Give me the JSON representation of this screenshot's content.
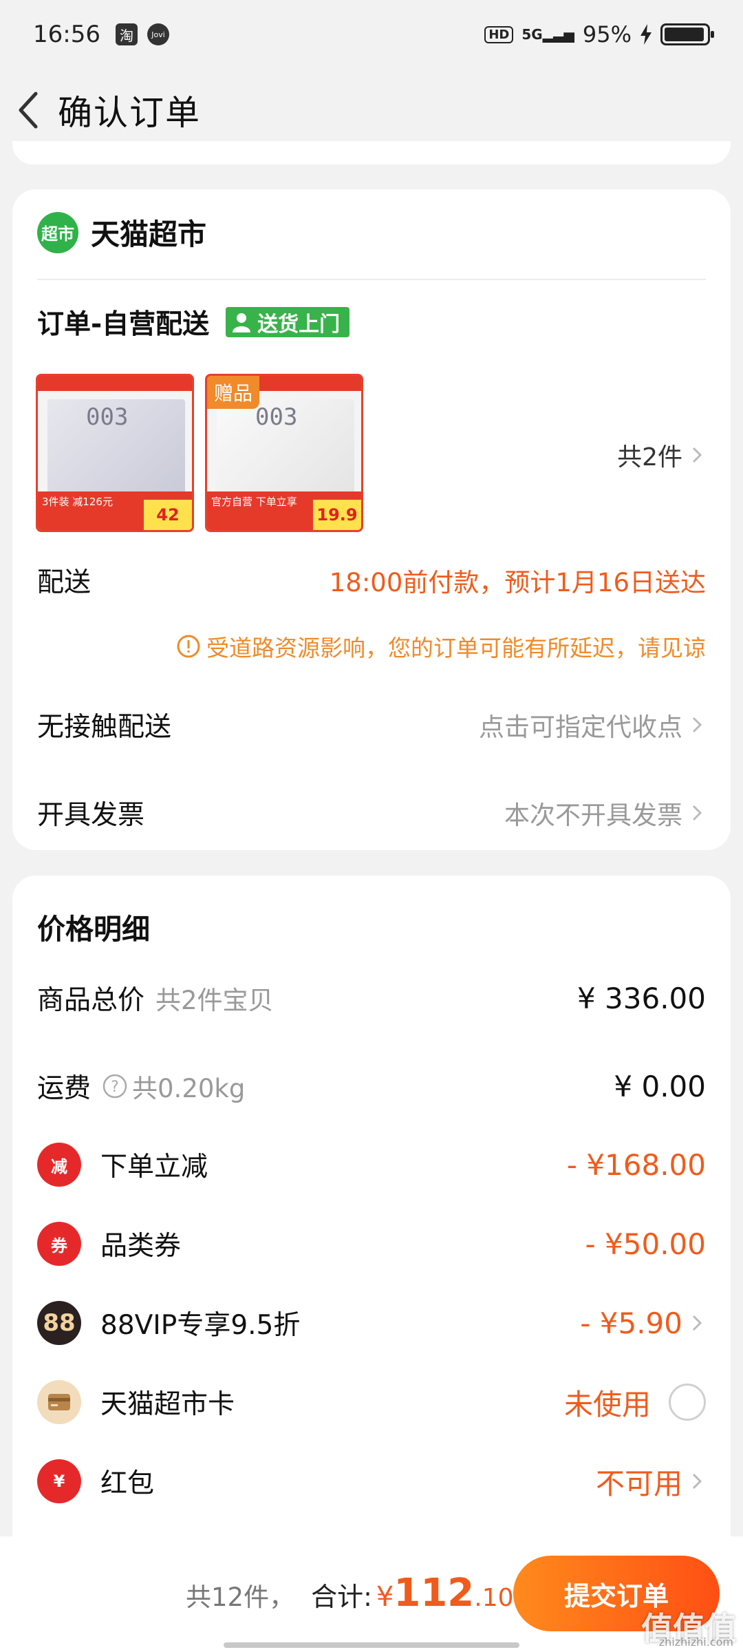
{
  "status_bar": {
    "time": "16:56",
    "app_icon_1": "淘",
    "app_icon_2": "Jovi",
    "hd": "HD",
    "network": "5G",
    "battery": "95%",
    "battery_level": 0.95
  },
  "nav": {
    "title": "确认订单"
  },
  "store": {
    "badge": "超市",
    "name": "天猫超市"
  },
  "order": {
    "title": "订单-自营配送",
    "delivery_tag": "送货上门",
    "items": [
      {
        "gift": "",
        "label": "003",
        "banner": "3件装 减126元",
        "price": "42"
      },
      {
        "gift": "赠品",
        "label": "003",
        "banner": "官方自营 下单立享",
        "price": "19.9"
      }
    ],
    "count": "共2件"
  },
  "delivery": {
    "label": "配送",
    "value": "18:00前付款，预计1月16日送达",
    "warning": "受道路资源影响，您的订单可能有所延迟，请见谅"
  },
  "contactless": {
    "label": "无接触配送",
    "value": "点击可指定代收点"
  },
  "invoice": {
    "label": "开具发票",
    "value": "本次不开具发票"
  },
  "price_detail": {
    "title": "价格明细",
    "goods_total": {
      "label": "商品总价",
      "sub": "共2件宝贝",
      "amount": "¥ 336.00"
    },
    "shipping": {
      "label": "运费",
      "sub": "共0.20kg",
      "amount": "¥ 0.00"
    },
    "discounts": [
      {
        "icon": "减",
        "label": "下单立减",
        "amount": "- ¥168.00"
      },
      {
        "icon": "券",
        "label": "品类券",
        "amount": "- ¥50.00"
      },
      {
        "icon": "88",
        "label": "88VIP专享9.5折",
        "amount": "- ¥5.90"
      },
      {
        "icon": "卡",
        "label": "天猫超市卡",
        "amount": "未使用"
      },
      {
        "icon": "¥",
        "label": "红包",
        "amount": "不可用"
      }
    ]
  },
  "footer": {
    "count": "共12件，",
    "total_label": "合计:",
    "currency": "¥",
    "total_int": "112",
    "total_dec": ".10",
    "submit": "提交订单"
  },
  "watermark": {
    "text": "值值值",
    "sub": "zhizhizhi.com"
  }
}
